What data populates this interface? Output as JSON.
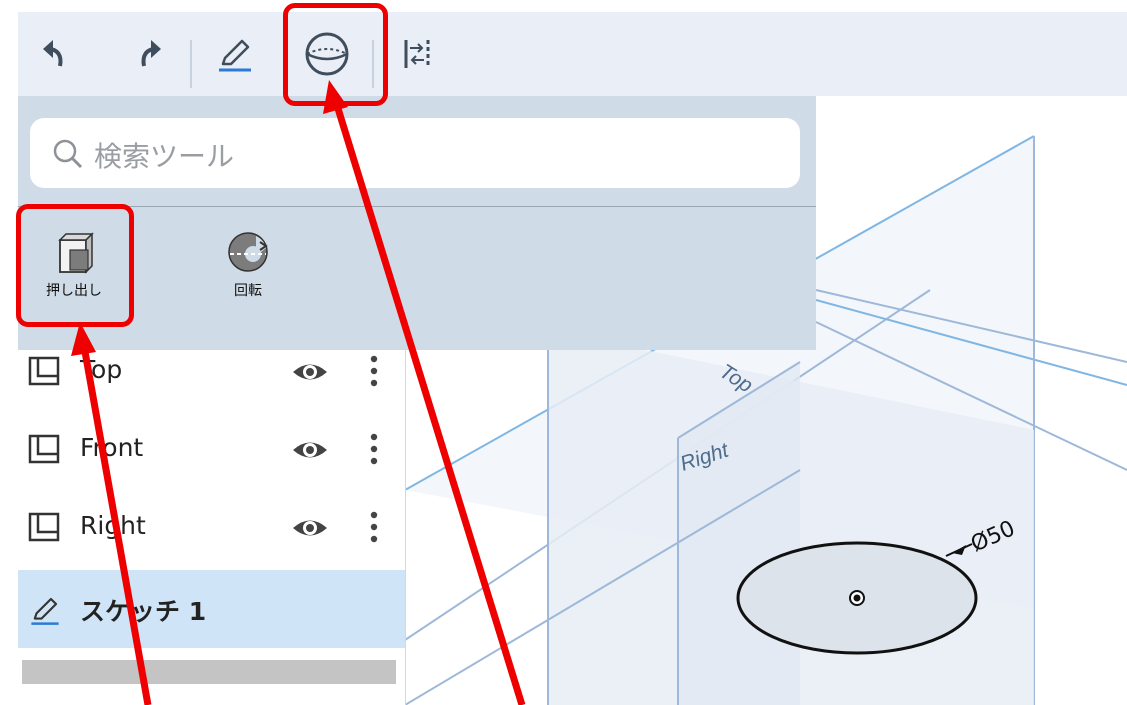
{
  "toolbar": {
    "items": [
      "undo-icon",
      "redo-icon",
      "sketch-pencil-icon",
      "part-studio-sphere-icon",
      "align-icon"
    ],
    "highlighted": "part-studio-sphere-icon"
  },
  "search": {
    "placeholder": "検索ツール"
  },
  "tools": [
    {
      "label": "押し出し",
      "icon": "extrude-icon",
      "highlighted": true
    },
    {
      "label": "回転",
      "icon": "revolve-icon",
      "highlighted": false
    }
  ],
  "features": [
    {
      "label": "Top",
      "icon": "plane-icon"
    },
    {
      "label": "Front",
      "icon": "plane-icon"
    },
    {
      "label": "Right",
      "icon": "plane-icon"
    },
    {
      "label": "スケッチ 1",
      "icon": "sketch-pencil-icon",
      "selected": true
    }
  ],
  "viewport": {
    "plane_top_label": "Top",
    "plane_right_label": "Right",
    "dimension_label": "Ø50"
  },
  "colors": {
    "accent": "#2b7bd3",
    "highlight": "#ee0000",
    "selected_row": "#cfe5f7",
    "panel": "#cfdbe6"
  }
}
